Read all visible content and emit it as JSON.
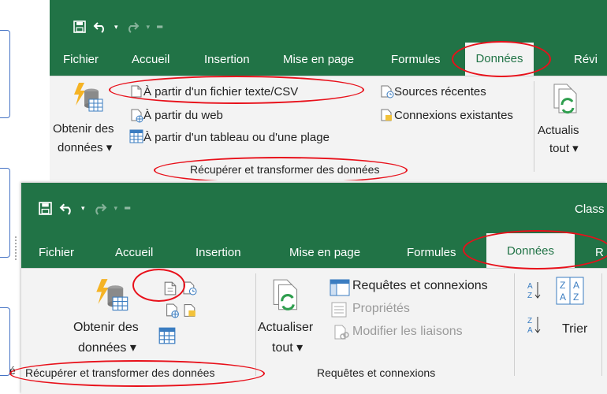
{
  "background_boxes": [
    {
      "name": "left-box-1"
    },
    {
      "name": "left-box-2"
    },
    {
      "name": "left-box-3"
    }
  ],
  "screenshot1": {
    "tabs": [
      "Fichier",
      "Accueil",
      "Insertion",
      "Mise en page",
      "Formules",
      "Données",
      "Révi"
    ],
    "active_tab": "Données",
    "get_data_label_line1": "Obtenir des",
    "get_data_label_line2": "données ▾",
    "from_text_csv": "À partir d'un fichier texte/CSV",
    "from_web": "À partir du web",
    "from_table_range": "À partir d'un tableau ou d'une plage",
    "recent_sources": "Sources récentes",
    "existing_connections": "Connexions existantes",
    "refresh_line1": "Actualis",
    "refresh_line2": "tout ▾",
    "group_label": "Récupérer et transformer des données"
  },
  "screenshot2": {
    "title": "Class",
    "tabs": [
      "Fichier",
      "Accueil",
      "Insertion",
      "Mise en page",
      "Formules",
      "Données",
      "R"
    ],
    "active_tab": "Données",
    "get_data_label_line1": "Obtenir des",
    "get_data_label_line2": "données ▾",
    "refresh_line1": "Actualiser",
    "refresh_line2": "tout ▾",
    "queries_connections": "Requêtes et connexions",
    "properties": "Propriétés",
    "edit_links": "Modifier les liaisons",
    "sort": "Trier",
    "group_label_get": "Récupérer et transformer des données",
    "group_label_queries": "Requêtes et connexions",
    "edge_fragment": "é"
  },
  "colors": {
    "excel_green": "#217346",
    "ribbon_bg": "#f3f3f3",
    "annotation_red": "#e8101a",
    "box_blue": "#4472c4"
  }
}
